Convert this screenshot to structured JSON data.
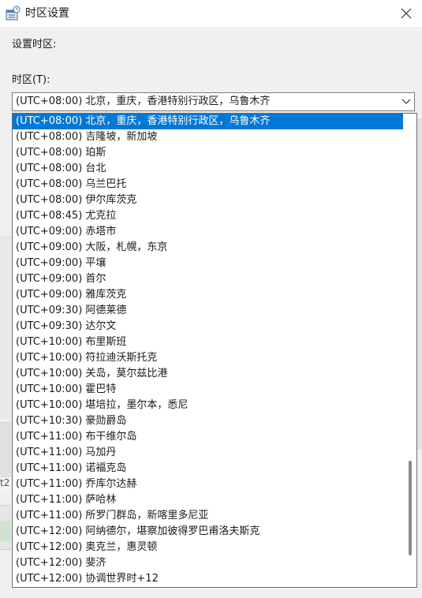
{
  "window": {
    "title": "时区设置",
    "icon": "timezone-app-icon",
    "close_icon": "close-icon"
  },
  "form": {
    "set_label": "设置时区:",
    "timezone_label": "时区(T):",
    "combo_value": "(UTC+08:00) 北京，重庆，香港特别行政区，乌鲁木齐",
    "selected_index": 0
  },
  "background": {
    "partial_text": "t2"
  },
  "colors": {
    "selection": "#0078d7",
    "window_bg": "#f0f0f0"
  },
  "list": [
    "(UTC+08:00) 北京，重庆，香港特别行政区，乌鲁木齐",
    "(UTC+08:00) 吉隆坡，新加坡",
    "(UTC+08:00) 珀斯",
    "(UTC+08:00) 台北",
    "(UTC+08:00) 乌兰巴托",
    "(UTC+08:00) 伊尔库茨克",
    "(UTC+08:45) 尤克拉",
    "(UTC+09:00) 赤塔市",
    "(UTC+09:00) 大阪，札幌，东京",
    "(UTC+09:00) 平壤",
    "(UTC+09:00) 首尔",
    "(UTC+09:00) 雅库茨克",
    "(UTC+09:30) 阿德莱德",
    "(UTC+09:30) 达尔文",
    "(UTC+10:00) 布里斯班",
    "(UTC+10:00) 符拉迪沃斯托克",
    "(UTC+10:00) 关岛，莫尔兹比港",
    "(UTC+10:00) 霍巴特",
    "(UTC+10:00) 堪培拉，墨尔本，悉尼",
    "(UTC+10:30) 豪勋爵岛",
    "(UTC+11:00) 布干维尔岛",
    "(UTC+11:00) 马加丹",
    "(UTC+11:00) 诺福克岛",
    "(UTC+11:00) 乔库尔达赫",
    "(UTC+11:00) 萨哈林",
    "(UTC+11:00) 所罗门群岛，新喀里多尼亚",
    "(UTC+12:00) 阿纳德尔，堪察加彼得罗巴甫洛夫斯克",
    "(UTC+12:00) 奥克兰，惠灵顿",
    "(UTC+12:00) 斐济",
    "(UTC+12:00) 协调世界时+12"
  ]
}
